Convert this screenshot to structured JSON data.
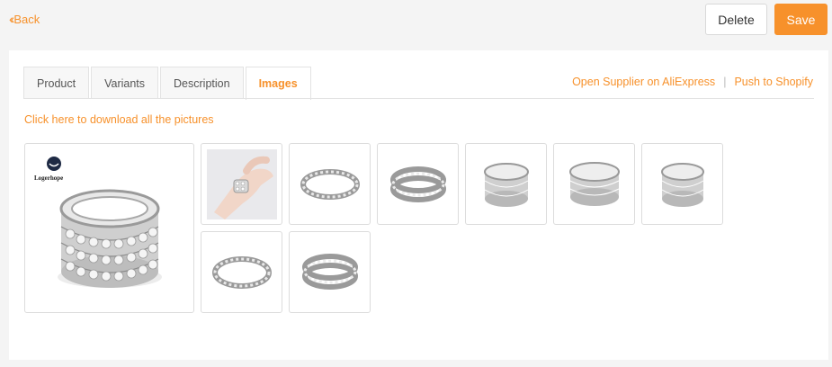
{
  "topbar": {
    "back_label": "Back",
    "delete_label": "Delete",
    "save_label": "Save"
  },
  "tabs": [
    {
      "label": "Product"
    },
    {
      "label": "Variants"
    },
    {
      "label": "Description"
    },
    {
      "label": "Images",
      "active": true
    }
  ],
  "links": {
    "open_supplier": "Open Supplier on AliExpress",
    "separator": "|",
    "push_shopify": "Push to Shopify"
  },
  "download_label": "Click here to download all the pictures",
  "main_image": {
    "brand_text": "Logerhope"
  },
  "colors": {
    "accent": "#f7912b",
    "border": "#dcdcdc",
    "background": "#f4f4f4"
  }
}
